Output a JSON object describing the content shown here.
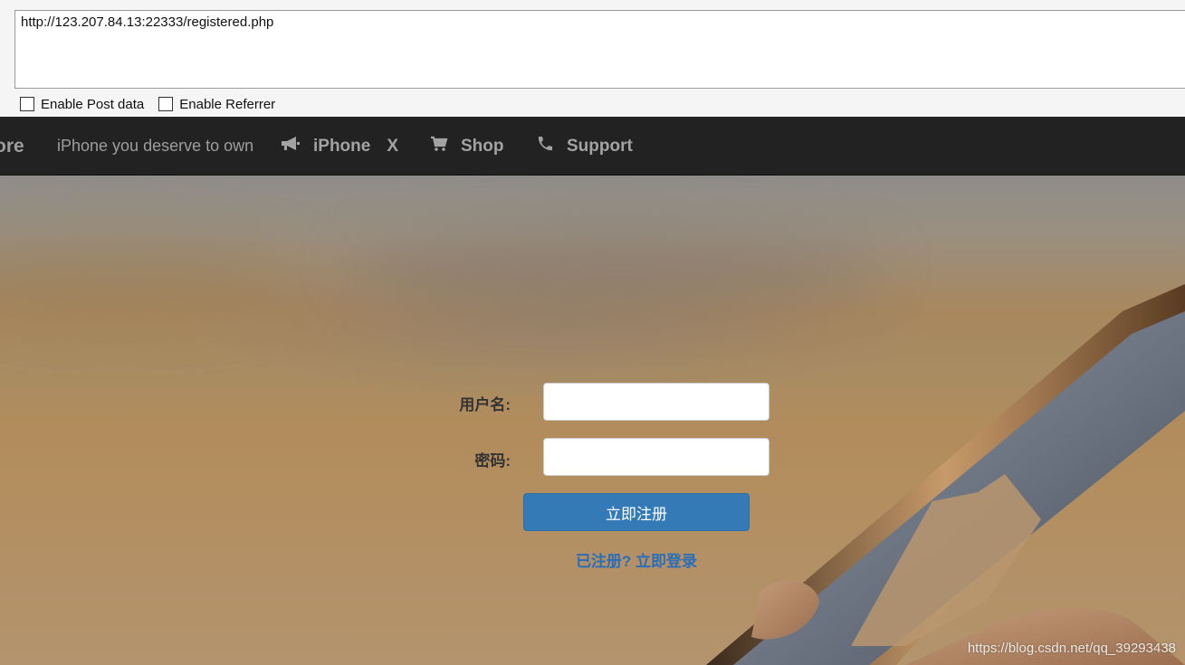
{
  "devbar": {
    "url_value": "http://123.207.84.13:22333/registered.php",
    "options": [
      {
        "label": "Enable Post data",
        "checked": false
      },
      {
        "label": "Enable Referrer",
        "checked": false
      }
    ]
  },
  "navbar": {
    "brand": "ore",
    "tagline": "iPhone you deserve to own",
    "items": [
      {
        "label": "iPhone",
        "icon": "megaphone-icon",
        "suffix": "X"
      },
      {
        "label": "Shop",
        "icon": "cart-icon"
      },
      {
        "label": "Support",
        "icon": "phone-icon"
      }
    ],
    "color": "#222222"
  },
  "form": {
    "username_label": "用户名:",
    "password_label": "密码:",
    "username_value": "",
    "password_value": "",
    "submit_label": "立即注册",
    "login_link": "已注册? 立即登录",
    "accent": "#337ab7"
  },
  "watermark": "https://blog.csdn.net/qq_39293438"
}
